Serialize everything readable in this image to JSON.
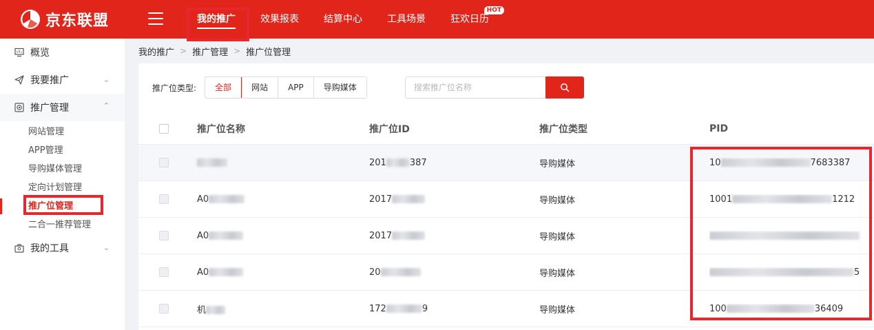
{
  "brand": {
    "name": "京东联盟"
  },
  "nav": {
    "menu_icon": "hamburger-icon",
    "items": [
      {
        "label": "我的推广"
      },
      {
        "label": "效果报表"
      },
      {
        "label": "结算中心"
      },
      {
        "label": "工具场景"
      },
      {
        "label": "狂欢日历",
        "badge": "HOT"
      }
    ]
  },
  "sidebar": {
    "overview": {
      "label": "概览",
      "icon": "monitor-icon"
    },
    "promote": {
      "label": "我要推广",
      "icon": "paper-plane-icon"
    },
    "manage": {
      "label": "推广管理",
      "icon": "target-icon",
      "children": [
        {
          "label": "网站管理"
        },
        {
          "label": "APP管理"
        },
        {
          "label": "导购媒体管理"
        },
        {
          "label": "定向计划管理"
        },
        {
          "label": "推广位管理"
        },
        {
          "label": "二合一推荐管理"
        }
      ]
    },
    "tools": {
      "label": "我的工具",
      "icon": "toolbox-icon"
    }
  },
  "breadcrumb": [
    "我的推广",
    "推广管理",
    "推广位管理"
  ],
  "filter": {
    "label": "推广位类型:",
    "options": [
      "全部",
      "网站",
      "APP",
      "导购媒体"
    ],
    "selected": "全部"
  },
  "search": {
    "placeholder": "搜索推广位名称",
    "icon": "search-icon"
  },
  "table": {
    "headers": {
      "name": "推广位名称",
      "id": "推广位ID",
      "type": "推广位类型",
      "pid": "PID"
    },
    "rows": [
      {
        "name_prefix": "",
        "id_prefix": "201",
        "id_suffix": "387",
        "type": "导购媒体",
        "pid_prefix": "10",
        "pid_suffix": "7683387"
      },
      {
        "name_prefix": "A0",
        "id_prefix": "2017",
        "id_suffix": "",
        "type": "导购媒体",
        "pid_prefix": "1001",
        "pid_suffix": "1212"
      },
      {
        "name_prefix": "A0",
        "id_prefix": "2017",
        "id_suffix": "",
        "type": "导购媒体",
        "pid_prefix": "",
        "pid_suffix": ""
      },
      {
        "name_prefix": "A0",
        "id_prefix": "20",
        "id_suffix": "",
        "type": "导购媒体",
        "pid_prefix": "",
        "pid_suffix": "5"
      },
      {
        "name_prefix": "机",
        "id_prefix": "172",
        "id_suffix": "9",
        "type": "导购媒体",
        "pid_prefix": "100",
        "pid_suffix": "36409"
      }
    ]
  },
  "colors": {
    "brand_red": "#e1251b",
    "highlight_red": "#e8262d"
  }
}
